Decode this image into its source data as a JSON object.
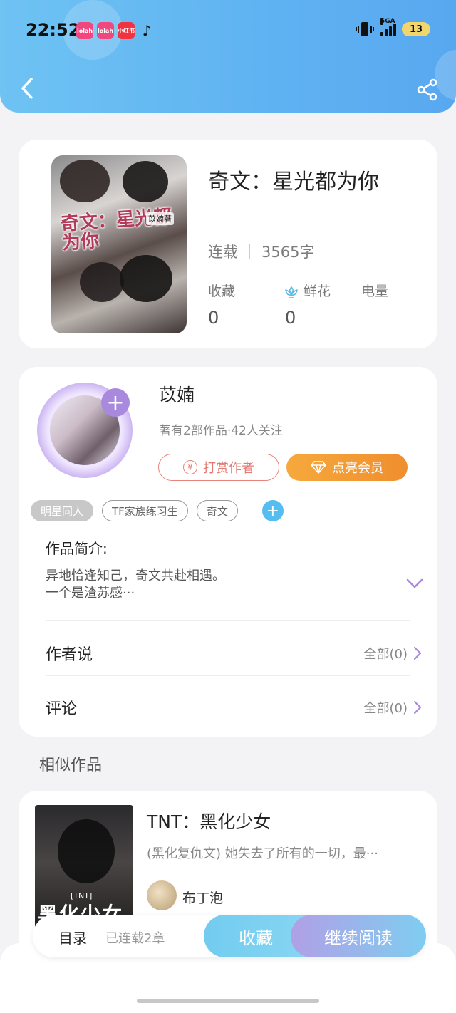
{
  "status_bar": {
    "time": "22:52",
    "apps": [
      "lolah",
      "lolah",
      "小红书",
      "douyin"
    ],
    "network": "5GA",
    "battery": "13"
  },
  "book": {
    "title": "奇文：星光都为你",
    "cover_title": "奇文：星光都为你",
    "cover_author": "苡婻著",
    "status": "连载",
    "word_count": "3565字",
    "stats": [
      {
        "label": "收藏",
        "value": "0"
      },
      {
        "label": "鲜花",
        "value": "0",
        "icon": "flower-icon"
      },
      {
        "label": "电量",
        "value": ""
      }
    ]
  },
  "author": {
    "name": "苡婻",
    "meta": "著有2部作品·42人关注",
    "tip_label": "打赏作者",
    "vip_label": "点亮会员"
  },
  "tags": [
    "明星同人",
    "TF家族练习生",
    "奇文"
  ],
  "intro": {
    "label": "作品简介:",
    "line1": "异地恰逢知己，奇文共赴相遇。",
    "line2": "一个是渣苏感···"
  },
  "rows": [
    {
      "label": "作者说",
      "right": "全部(0)"
    },
    {
      "label": "评论",
      "right": "全部(0)"
    }
  ],
  "similar": {
    "section_title": "相似作品",
    "title": "TNT：黑化少女",
    "desc": "(黑化复仇文) 她失去了所有的一切，最···",
    "author": "布丁泡",
    "cover_title": "黑化少女",
    "cover_tag": "[TNT]"
  },
  "bottom_bar": {
    "toc_label": "目录",
    "serial_label": "已连载2章",
    "fav_label": "收藏",
    "read_label": "继续阅读"
  },
  "colors": {
    "header_blue": "#5fb2f2",
    "accent_orange": "#ef8e2e",
    "accent_purple": "#a989dd",
    "tip_red": "#e47a72"
  }
}
